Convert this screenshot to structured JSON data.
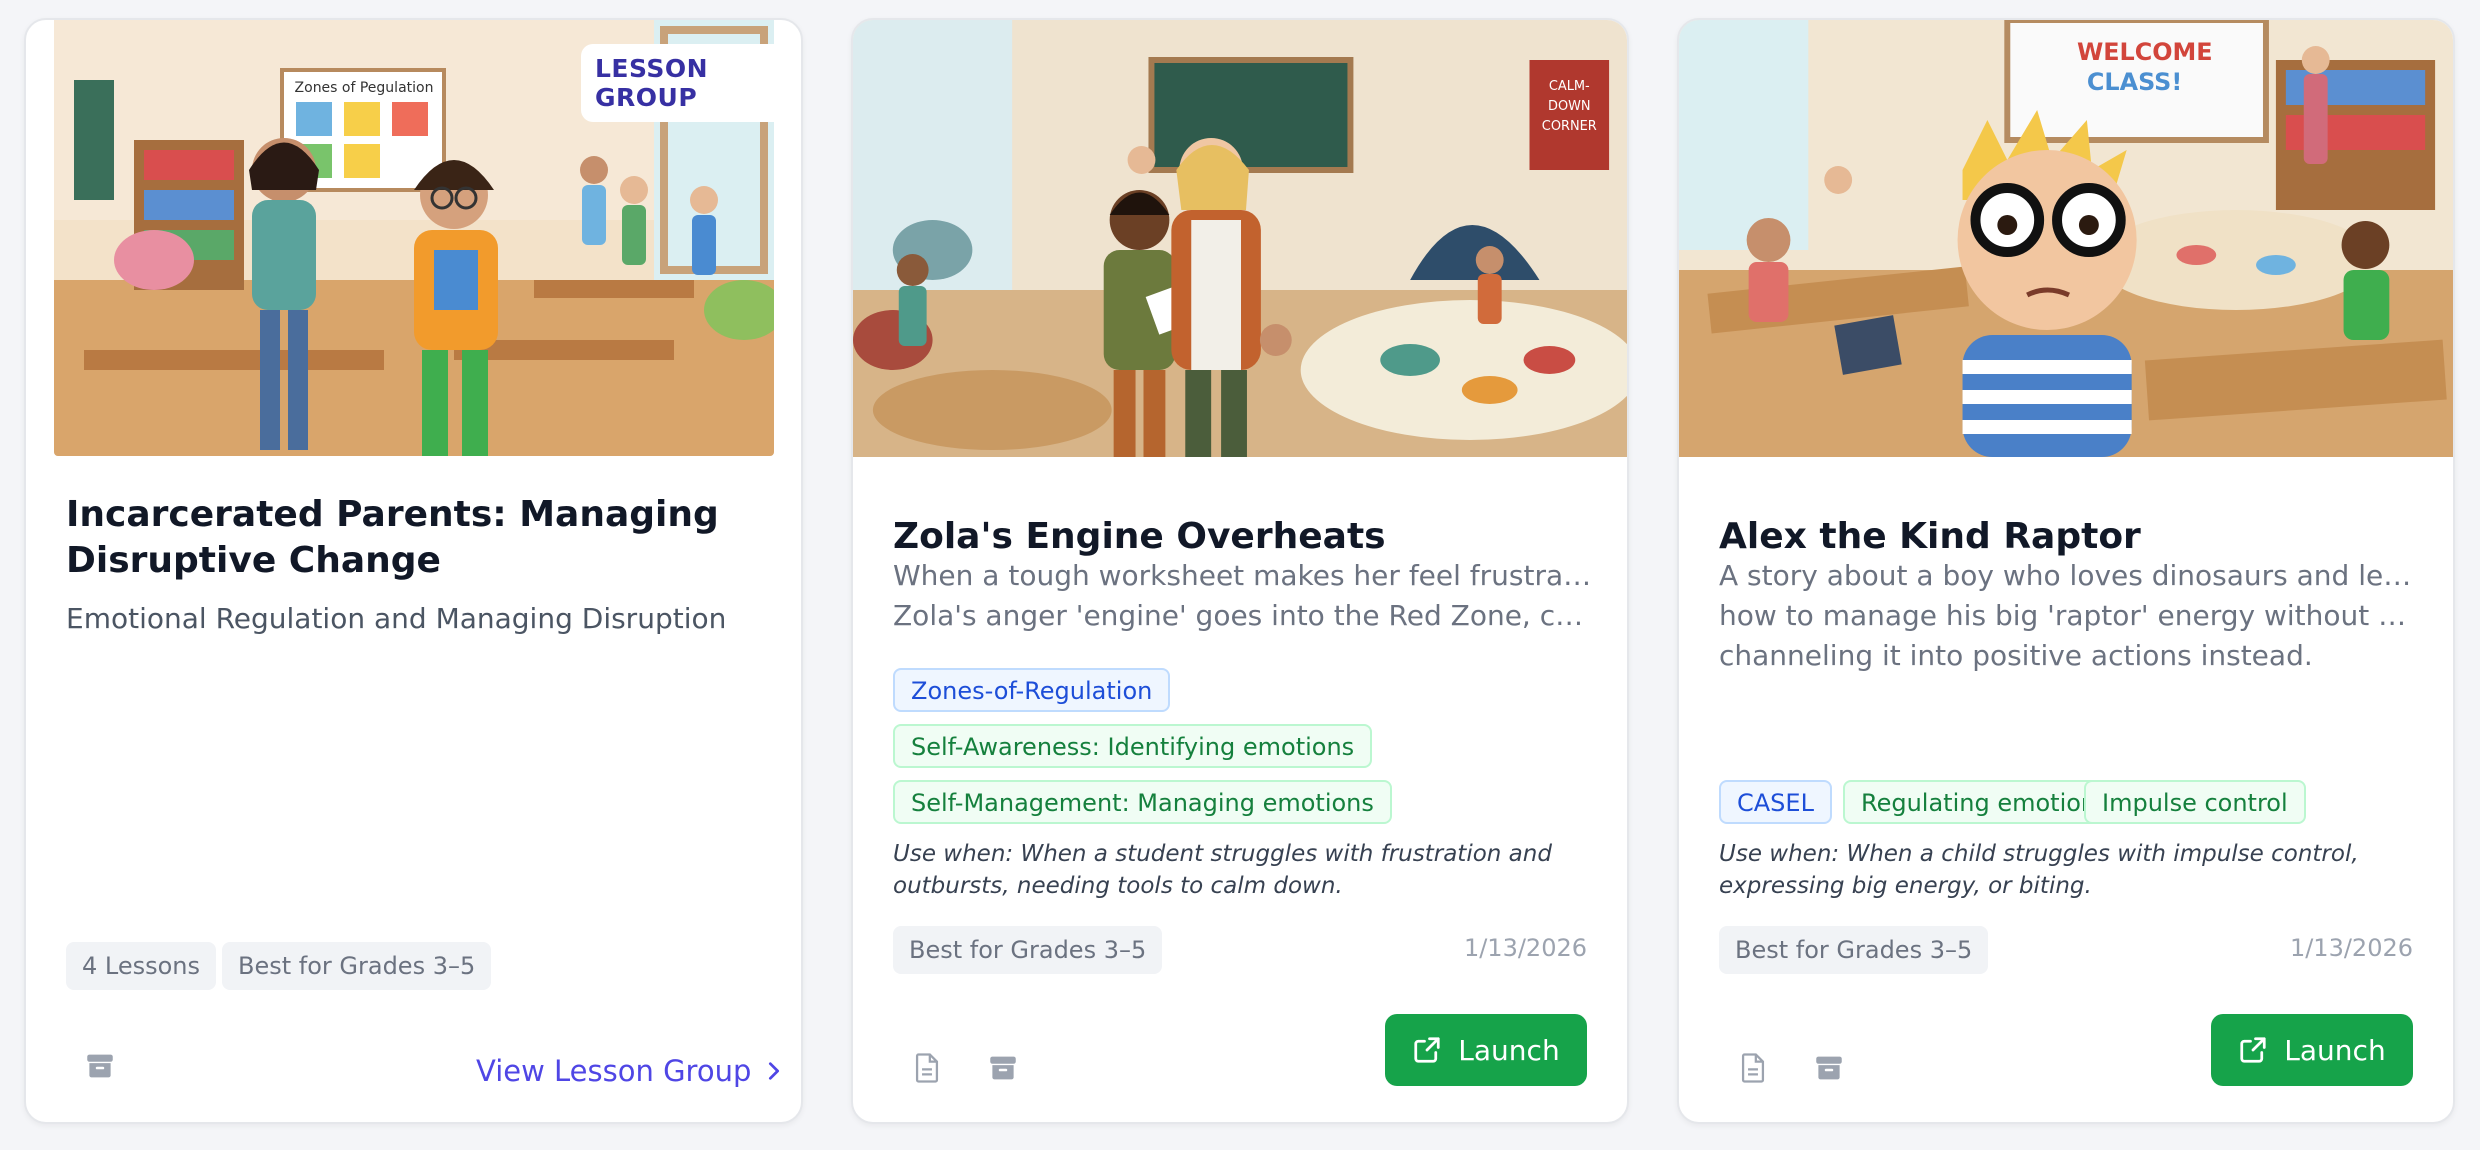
{
  "cards": [
    {
      "badge": "LESSON GROUP",
      "title": "Incarcerated Parents: Managing Disruptive Change",
      "subtitle": "Emotional Regulation and Managing Disruption",
      "pills": [
        "4 Lessons",
        "Best for Grades 3–5"
      ],
      "image_text": "Zones of Pegulation",
      "action": "View Lesson Group",
      "icons": [
        "archive-icon",
        "chevron-right-icon"
      ]
    },
    {
      "title": "Zola's Engine Overheats",
      "description": [
        "When a tough worksheet makes her feel frustrated,",
        "Zola's anger 'engine' goes into the Red Zone, causing..."
      ],
      "tags": [
        "Zones-of-Regulation",
        "Self-Awareness: Identifying emotions",
        "Self-Management: Managing emotions"
      ],
      "use_when": "Use when: When a student struggles with frustration and outbursts, needing tools to calm down.",
      "grade": "Best for Grades 3–5",
      "date": "1/13/2026",
      "image_text": "CALM-DOWN CORNER",
      "action": "Launch",
      "icons": [
        "document-icon",
        "archive-icon",
        "external-link-icon"
      ]
    },
    {
      "title": "Alex the Kind Raptor",
      "description": [
        "A story about a boy who loves dinosaurs and learns",
        "how to manage his big 'raptor' energy without biting,...",
        "channeling it into positive actions instead."
      ],
      "tags": [
        "CASEL",
        "Regulating emotions",
        "Impulse control"
      ],
      "use_when": "Use when: When a child struggles with impulse control, expressing big energy, or biting.",
      "grade": "Best for Grades 3–5",
      "date": "1/13/2026",
      "image_text": "WELCOME CLASS!",
      "action": "Launch",
      "icons": [
        "document-icon",
        "archive-icon",
        "external-link-icon"
      ]
    }
  ],
  "colors": {
    "accent_indigo": "#4f46e5",
    "launch_green": "#16a34a",
    "tag_blue": "#1d4ed8",
    "tag_green": "#15803d"
  }
}
